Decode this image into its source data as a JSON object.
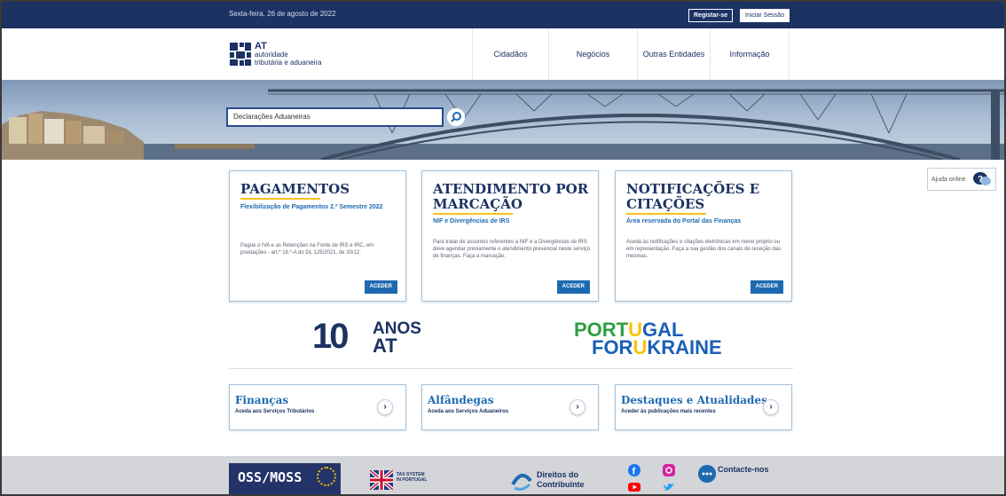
{
  "topbar": {
    "date": "Sexta-feira, 26 de agosto de 2022",
    "register_label": "Registar-se",
    "login_label": "Iniciar Sessão"
  },
  "header": {
    "logo": {
      "line1": "AT",
      "line2": "autoridade",
      "line3": "tributária e aduaneira"
    },
    "nav": [
      {
        "label": "Cidadãos"
      },
      {
        "label": "Negócios"
      },
      {
        "label": "Outras Entidades"
      },
      {
        "label": "Informação"
      }
    ]
  },
  "search": {
    "value": "Declarações Aduaneiras"
  },
  "cards": [
    {
      "title": "PAGAMENTOS",
      "subtitle": "Flexibilização de Pagamentos 2.º Semestre 2022",
      "text": "Pague o IVA e as Retenções na Fonte de IRS e IRC, em prestações - art.º 16.º-A do DL 125/2021, de 30/12.",
      "button": "ACEDER"
    },
    {
      "title": "ATENDIMENTO POR MARCAÇÃO",
      "subtitle": "NIF e Divergências de IRS",
      "text": "Para tratar de assuntos referentes a NIF e a Divergências de IRS deve agendar previamente o atendimento presencial neste serviço de finanças. Faça a marcação.",
      "button": "ACEDER"
    },
    {
      "title": "NOTIFICAÇÕES E CITAÇÕES",
      "subtitle": "Área reservada do Portal das Finanças",
      "text": "Aceda às notificações e citações eletrónicas em nome próprio ou em representação. Faça a sua gestão dos canais de receção das mesmas.",
      "button": "ACEDER"
    }
  ],
  "help": {
    "label": "Ajuda online"
  },
  "banners": {
    "anos": {
      "number": "10",
      "word1": "ANOS",
      "word2": "AT"
    },
    "ukraine": {
      "line1a": "PORT",
      "line1b": "U",
      "line1c": "GAL",
      "line2a": "FOR",
      "line2b": "U",
      "line2c": "KRAINE"
    }
  },
  "links": [
    {
      "title": "Finanças",
      "subtitle": "Aceda aos Serviços Tributários"
    },
    {
      "title": "Alfândegas",
      "subtitle": "Aceda aos Serviços Aduaneiros"
    },
    {
      "title": "Destaques e Atualidades",
      "subtitle": "Aceder às publicações mais recentes"
    }
  ],
  "footer": {
    "oss": "OSS/MOSS",
    "tax_system": {
      "line1": "TAX SYSTEM",
      "line2": "IN PORTUGAL"
    },
    "rights": {
      "line1": "Direitos do",
      "line2": "Contribuinte"
    },
    "contact": "Contacte-nos",
    "social_icons": [
      "facebook-icon",
      "instagram-icon",
      "youtube-icon",
      "twitter-icon"
    ]
  },
  "colors": {
    "primary": "#1b3263",
    "accent": "#1e6ab1",
    "highlight": "#f6c21a"
  }
}
